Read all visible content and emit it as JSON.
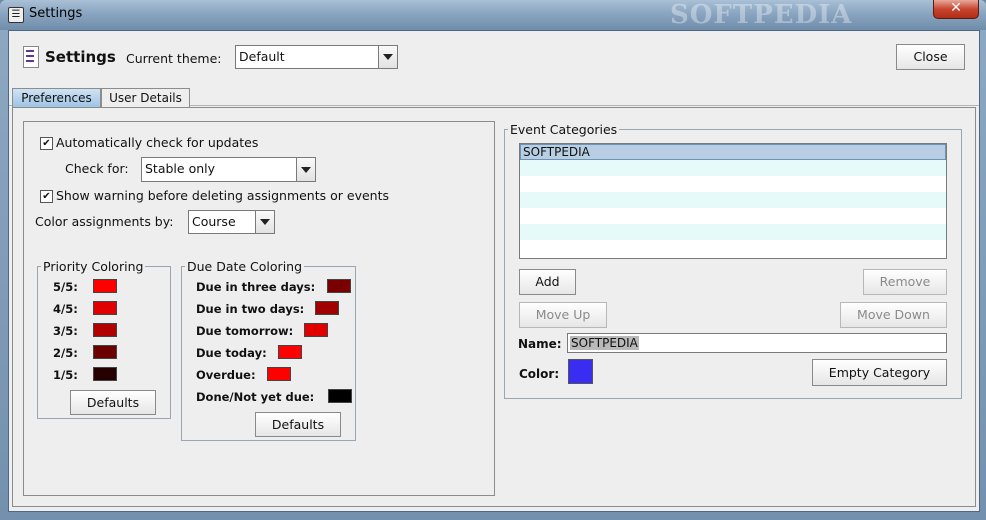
{
  "window": {
    "title": "Settings",
    "watermark": "SOFTPEDIA",
    "close_glyph": "✕"
  },
  "header": {
    "title": "Settings",
    "theme_label": "Current theme:",
    "theme_value": "Default",
    "close_label": "Close"
  },
  "tabs": [
    {
      "label": "Preferences",
      "active": true
    },
    {
      "label": "User Details",
      "active": false
    }
  ],
  "preferences": {
    "auto_update_label": "Automatically check for updates",
    "auto_update_checked": true,
    "check_for_label": "Check for:",
    "check_for_value": "Stable only",
    "show_warning_label": "Show warning before deleting assignments or events",
    "show_warning_checked": true,
    "color_by_label": "Color assignments by:",
    "color_by_value": "Course",
    "priority": {
      "title": "Priority Coloring",
      "rows": [
        {
          "label": "5/5:",
          "color": "#ff0000"
        },
        {
          "label": "4/5:",
          "color": "#e00000"
        },
        {
          "label": "3/5:",
          "color": "#b00000"
        },
        {
          "label": "2/5:",
          "color": "#6a0000"
        },
        {
          "label": "1/5:",
          "color": "#250000"
        }
      ],
      "defaults_label": "Defaults"
    },
    "due_date": {
      "title": "Due Date Coloring",
      "rows": [
        {
          "label": "Due in three days:",
          "color": "#7a0000"
        },
        {
          "label": "Due in two days:",
          "color": "#a00000"
        },
        {
          "label": "Due tomorrow:",
          "color": "#e00000"
        },
        {
          "label": "Due today:",
          "color": "#ff0000"
        },
        {
          "label": "Overdue:",
          "color": "#ff0000"
        },
        {
          "label": "Done/Not yet due:",
          "color": "#000000"
        }
      ],
      "defaults_label": "Defaults"
    }
  },
  "event_categories": {
    "title": "Event Categories",
    "items": [
      "SOFTPEDIA"
    ],
    "selected_index": 0,
    "add_label": "Add",
    "remove_label": "Remove",
    "move_up_label": "Move Up",
    "move_down_label": "Move Down",
    "name_label": "Name:",
    "name_value": "SOFTPEDIA",
    "color_label": "Color:",
    "color_value": "#3a2df2",
    "empty_label": "Empty Category"
  }
}
